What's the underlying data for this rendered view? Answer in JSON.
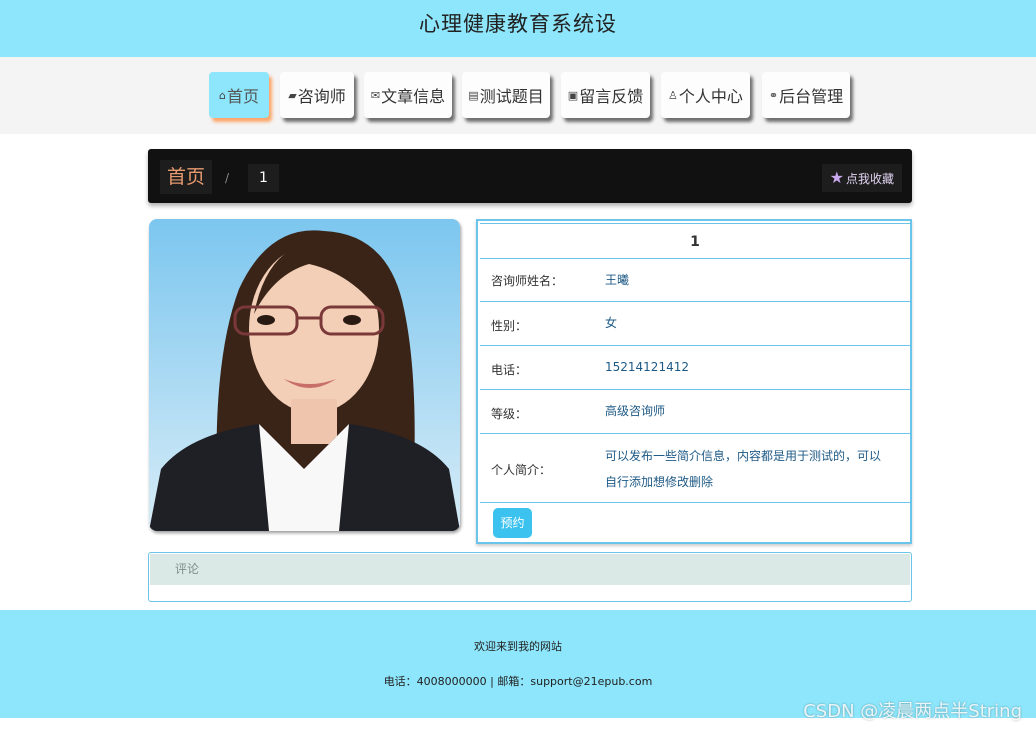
{
  "site": {
    "title": "心理健康教育系统设"
  },
  "nav": {
    "items": [
      {
        "icon": "home-icon",
        "glyph": "⌂",
        "label": "首页"
      },
      {
        "icon": "graduation-cap-icon",
        "glyph": "▰",
        "label": "咨询师"
      },
      {
        "icon": "envelope-icon",
        "glyph": "✉",
        "label": "文章信息"
      },
      {
        "icon": "calendar-icon",
        "glyph": "▤",
        "label": "测试题目"
      },
      {
        "icon": "gift-icon",
        "glyph": "▣",
        "label": "留言反馈"
      },
      {
        "icon": "user-icon",
        "glyph": "♙",
        "label": "个人中心"
      },
      {
        "icon": "link-icon",
        "glyph": "⚭",
        "label": "后台管理"
      }
    ]
  },
  "breadcrumb": {
    "home": "首页",
    "separator": "/",
    "current": "1"
  },
  "favorite": {
    "label": "点我收藏",
    "icon": "star-icon",
    "glyph": "★"
  },
  "detail": {
    "heading": "1",
    "fields": [
      {
        "label": "咨询师姓名：",
        "value": "王曦"
      },
      {
        "label": "性别：",
        "value": "女"
      },
      {
        "label": "电话：",
        "value": "15214121412"
      },
      {
        "label": "等级：",
        "value": "高级咨询师"
      },
      {
        "label": "个人简介：",
        "value": "可以发布一些简介信息，内容都是用于测试的，可以自行添加想修改删除"
      }
    ],
    "book_button": "预约"
  },
  "comment": {
    "title": "评论"
  },
  "footer": {
    "welcome": "欢迎来到我的网站",
    "contact": "电话：4008000000 | 邮箱：support@21epub.com"
  },
  "watermark": "CSDN @凌晨两点半String",
  "colors": {
    "accent": "#8de6fb",
    "border": "#6bc4ea",
    "button": "#3cc2ef",
    "value_text": "#1e5a86"
  }
}
